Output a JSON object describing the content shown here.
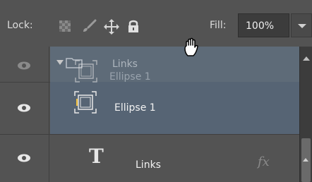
{
  "toolbar": {
    "lock_label": "Lock:",
    "lock_icons": [
      "lock-transparent-pixels-icon",
      "lock-image-pixels-icon",
      "lock-position-icon",
      "lock-all-icon"
    ],
    "fill_label": "Fill:",
    "fill_value": "100%"
  },
  "layers": [
    {
      "type": "group",
      "name": "Links",
      "visible": true,
      "expanded": true
    },
    {
      "type": "shape",
      "name": "Ellipse 1",
      "visible": true,
      "selected": true
    },
    {
      "type": "text",
      "name": "Links",
      "visible": true,
      "has_effects": true,
      "effects_label": "fx"
    }
  ],
  "drag_ghost": {
    "name": "Ellipse 1"
  },
  "colors": {
    "panel_bg": "#535353",
    "selected_row": "#566474",
    "group_row": "#5e6b78"
  },
  "cursor": "grab-hand-icon"
}
